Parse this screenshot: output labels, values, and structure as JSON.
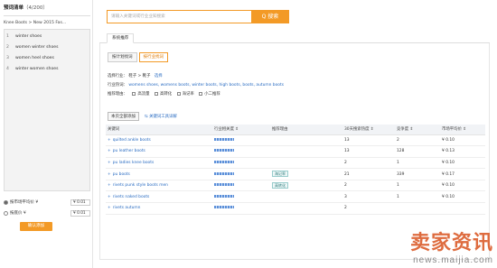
{
  "left": {
    "title": "预词清单",
    "count": "（4/200）",
    "breadcrumb": "Knee Boots > New 2015 Fas...",
    "items": [
      {
        "n": "1",
        "label": "winter shoes"
      },
      {
        "n": "2",
        "label": "women winter shoes"
      },
      {
        "n": "3",
        "label": "women heel shoes"
      },
      {
        "n": "4",
        "label": "winter women shoes"
      }
    ],
    "options": [
      {
        "label": "按市场平均价 ¥",
        "value": "¥ 0.01",
        "checked": true
      },
      {
        "label": "按底价 ¥",
        "value": "¥ 0.01",
        "checked": false
      }
    ],
    "confirm": "确认添加"
  },
  "search": {
    "placeholder": "请输入关键词或行业业知搜索",
    "button": "Q 搜索"
  },
  "tabs": {
    "main": "系统推荐"
  },
  "subtabs": [
    "按计划找词",
    "按行业找词"
  ],
  "filters": {
    "industry_label": "选择行业：",
    "industry_value": "鞋子 > 靴子",
    "industry_link": "选择",
    "hot_label": "行业热词：",
    "hot_words": "womens shoes,  womens boots,  winter boots,  high boots,  boots,  autumn boots",
    "reason_label": "推荐理由：",
    "reasons": [
      "高流量",
      "高转化",
      "海记率",
      "小二推荐"
    ]
  },
  "actions": {
    "add_all": "本页全部添加",
    "tool_help": "关键词工具详解"
  },
  "table": {
    "headers": [
      "关键词",
      "行业相关度 ⇕",
      "推荐理由",
      "30天搜索热度 ⇕",
      "竞争度 ⇕",
      "市场平均价 ⇕"
    ],
    "rows": [
      {
        "kw": "quilted ankle boots",
        "reason": "",
        "heat": "13",
        "comp": "2",
        "price": "¥ 0.10"
      },
      {
        "kw": "pu leather boots",
        "reason": "",
        "heat": "13",
        "comp": "128",
        "price": "¥ 0.13"
      },
      {
        "kw": "pu ladies knee boots",
        "reason": "",
        "heat": "2",
        "comp": "1",
        "price": "¥ 0.10"
      },
      {
        "kw": "pu boots",
        "reason": "海记率",
        "heat": "21",
        "comp": "339",
        "price": "¥ 0.17"
      },
      {
        "kw": "rivets punk style boots men",
        "reason": "高转化",
        "heat": "2",
        "comp": "1",
        "price": "¥ 0.10"
      },
      {
        "kw": "rivets naked boots",
        "reason": "",
        "heat": "3",
        "comp": "1",
        "price": "¥ 0.10"
      },
      {
        "kw": "rivets autumn",
        "reason": "",
        "heat": "2",
        "comp": "",
        "price": ""
      }
    ]
  },
  "watermark": {
    "big": "卖家资讯",
    "small": "news.maijia.com"
  },
  "colors": {
    "accent": "#f39a26",
    "link": "#2a6cc2"
  }
}
